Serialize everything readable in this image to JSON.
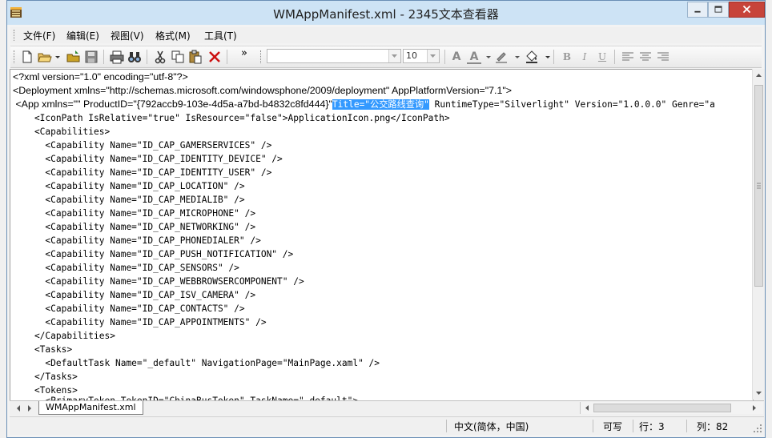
{
  "window": {
    "title": "WMAppManifest.xml - 2345文本查看器"
  },
  "menu": {
    "items": [
      {
        "label": "文件(F)"
      },
      {
        "label": "编辑(E)"
      },
      {
        "label": "视图(V)"
      },
      {
        "label": "格式(M)"
      },
      {
        "label": "工具(T)"
      }
    ]
  },
  "toolbar": {
    "overflow_label": "»",
    "font_name": "",
    "font_size": "10",
    "bold_label": "B",
    "italic_label": "I",
    "underline_label": "U",
    "font_a_label": "A",
    "font_color_label": "A"
  },
  "editor": {
    "lines": [
      "<?xml version=\"1.0\" encoding=\"utf-8\"?>",
      "<Deployment xmlns=\"http://schemas.microsoft.com/windowsphone/2009/deployment\" AppPlatformVersion=\"7.1\">",
      " <App xmlns=\"\" ProductID=\"{792accb9-103e-4d5a-a7bd-b4832c8fd444}\"",
      "Title=\"公交路线查询\"",
      " RuntimeType=\"Silverlight\" Version=\"1.0.0.0\" Genre=\"a",
      "    <IconPath IsRelative=\"true\" IsResource=\"false\">ApplicationIcon.png</IconPath>",
      "    <Capabilities>",
      "      <Capability Name=\"ID_CAP_GAMERSERVICES\" />",
      "      <Capability Name=\"ID_CAP_IDENTITY_DEVICE\" />",
      "      <Capability Name=\"ID_CAP_IDENTITY_USER\" />",
      "      <Capability Name=\"ID_CAP_LOCATION\" />",
      "      <Capability Name=\"ID_CAP_MEDIALIB\" />",
      "      <Capability Name=\"ID_CAP_MICROPHONE\" />",
      "      <Capability Name=\"ID_CAP_NETWORKING\" />",
      "      <Capability Name=\"ID_CAP_PHONEDIALER\" />",
      "      <Capability Name=\"ID_CAP_PUSH_NOTIFICATION\" />",
      "      <Capability Name=\"ID_CAP_SENSORS\" />",
      "      <Capability Name=\"ID_CAP_WEBBROWSERCOMPONENT\" />",
      "      <Capability Name=\"ID_CAP_ISV_CAMERA\" />",
      "      <Capability Name=\"ID_CAP_CONTACTS\" />",
      "      <Capability Name=\"ID_CAP_APPOINTMENTS\" />",
      "    </Capabilities>",
      "    <Tasks>",
      "      <DefaultTask Name=\"_default\" NavigationPage=\"MainPage.xaml\" />",
      "    </Tasks>",
      "    <Tokens>",
      "      <PrimaryToken TokenID=\"ChinaBusToken\" TaskName=\"_default\">"
    ]
  },
  "tabs": {
    "active": "WMAppManifest.xml"
  },
  "status": {
    "encoding": "中文(简体，中国)",
    "mode": "可写",
    "row": "行：3",
    "col": "列：82"
  },
  "colors": {
    "selection": "#3399ff",
    "titlebar": "#cde3f5",
    "close_button": "#c7443a"
  }
}
